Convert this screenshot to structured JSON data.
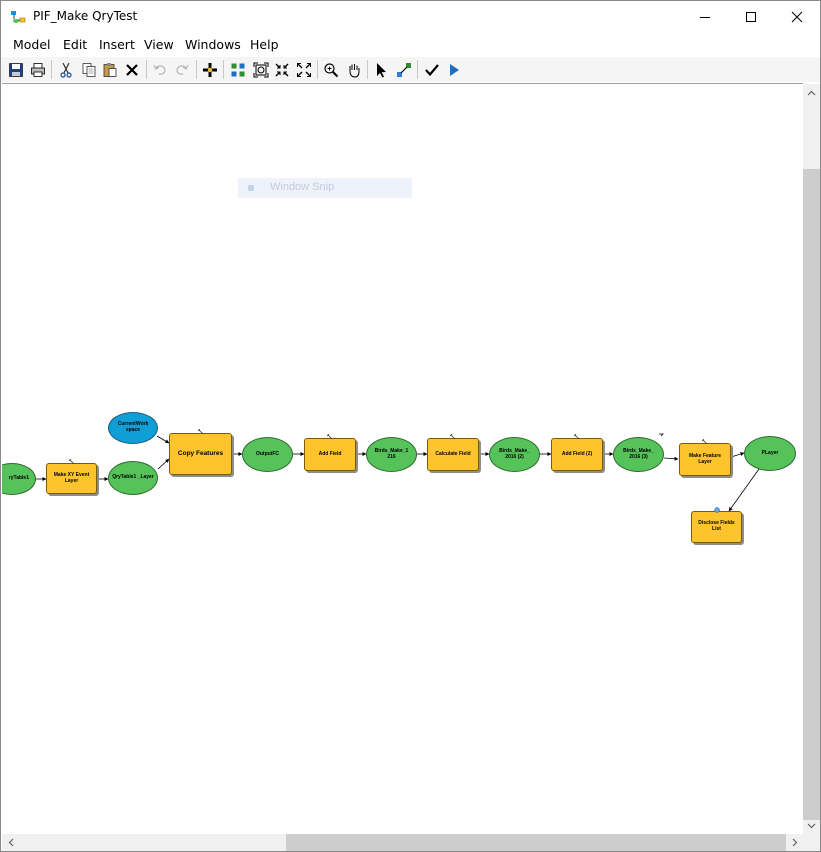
{
  "window": {
    "title": "PIF_Make QryTest",
    "controls": [
      "minimize",
      "maximize",
      "close"
    ]
  },
  "menubar": {
    "items": [
      "Model",
      "Edit",
      "Insert",
      "View",
      "Windows",
      "Help"
    ]
  },
  "toolbar": {
    "buttons": [
      "save-icon",
      "print-icon",
      "cut-icon",
      "copy-icon",
      "paste-icon",
      "delete-icon",
      "undo-icon",
      "redo-icon",
      "add-data-icon",
      "auto-layout-icon",
      "full-extent-icon",
      "fixed-zoom-in-icon",
      "fixed-zoom-out-icon",
      "zoom-in-icon",
      "pan-icon",
      "select-icon",
      "connect-icon",
      "validate-icon",
      "run-icon"
    ]
  },
  "overlay": {
    "window_snip": "Window Snip"
  },
  "model": {
    "nodes": {
      "qrytable1": {
        "label": "ryTable1",
        "kind": "data"
      },
      "make_xy_event_layer": {
        "label": "Make XY Event Layer",
        "kind": "tool"
      },
      "qrytable1_layer": {
        "label": "QryTable1 _Layer",
        "kind": "data"
      },
      "current_workspace": {
        "label": "CurrentWork space",
        "kind": "variable"
      },
      "copy_features": {
        "label": "Copy Features",
        "kind": "tool"
      },
      "outputfc": {
        "label": "OutputFC",
        "kind": "data"
      },
      "add_field": {
        "label": "Add Field",
        "kind": "tool"
      },
      "birds_make_1": {
        "label": "Birds_Make_1 216",
        "kind": "data"
      },
      "calculate_field": {
        "label": "Calculate Field",
        "kind": "tool"
      },
      "birds_make_2": {
        "label": "Birds_Make_ 2016 (2)",
        "kind": "data"
      },
      "add_field_2": {
        "label": "Add Field (2)",
        "kind": "tool"
      },
      "birds_make_3": {
        "label": "Birds_Make_ 2016 (3)",
        "kind": "data"
      },
      "make_feature_layer": {
        "label": "Make Feature Layer",
        "kind": "tool"
      },
      "player": {
        "label": "PLayer",
        "kind": "data"
      },
      "disclose_fields_list": {
        "label": "Disclose Fields List",
        "kind": "tool"
      }
    }
  },
  "colors": {
    "tool": "#fdc52b",
    "data": "#56c35a",
    "variable": "#0f9fd6"
  }
}
